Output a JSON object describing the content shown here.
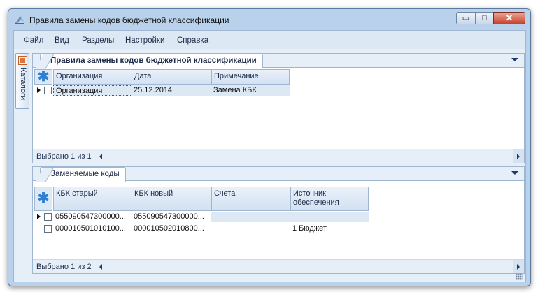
{
  "window": {
    "title": "Правила замены кодов бюджетной классификации",
    "minimize_glyph": "▭",
    "maximize_glyph": "□",
    "close_glyph": "✕"
  },
  "menu": {
    "items": [
      "Файл",
      "Вид",
      "Разделы",
      "Настройки",
      "Справка"
    ]
  },
  "side_tab": {
    "label": "Каталоги",
    "icon": "catalog-icon"
  },
  "top_panel": {
    "tab_label": "Правила замены кодов бюджетной классификации",
    "columns": [
      "Организация",
      "Дата",
      "Примечание"
    ],
    "rows": [
      {
        "current": true,
        "organization": "Организация",
        "date": "25.12.2014",
        "note": "Замена КБК"
      }
    ],
    "footer": "Выбрано 1 из 1"
  },
  "bottom_panel": {
    "tab_label": "Заменяемые коды",
    "columns": [
      "КБК старый",
      "КБК новый",
      "Счета",
      "Источник обеспечения"
    ],
    "rows": [
      {
        "current": true,
        "old": "055090547300000...",
        "new": "055090547300000...",
        "accounts": "",
        "source": ""
      },
      {
        "current": false,
        "old": "000010501010100...",
        "new": "000010502010800...",
        "accounts": "",
        "source": "1 Бюджет"
      }
    ],
    "footer": "Выбрано 1 из 2"
  },
  "colors": {
    "accent": "#2f7fd0",
    "frame": "#b9d1ea",
    "selection": "#dde8f5"
  }
}
